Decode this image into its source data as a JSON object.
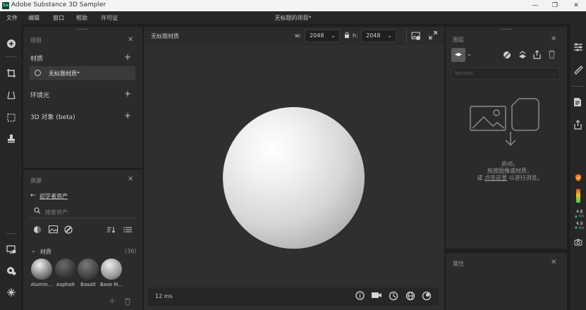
{
  "app": {
    "logo_text": "Sa",
    "title": "Adobe Substance 3D Sampler",
    "document_title": "无标题的项目*"
  },
  "window_controls": {
    "minimize": "—",
    "maximize": "❐",
    "close": "✕"
  },
  "menu": {
    "items": [
      "文件",
      "编辑",
      "窗口",
      "帮助",
      "许可证"
    ]
  },
  "left_toolbar": {
    "icons": [
      "plus-icon",
      "crop-icon",
      "perspective-icon",
      "transform-icon",
      "stamp-icon",
      "display-icon",
      "settings-icon",
      "network-icon"
    ]
  },
  "project_panel": {
    "title": "项目",
    "sections": {
      "materials": "材质",
      "environment": "环境光",
      "objects": "3D 对象 (beta)"
    },
    "material_item": "无标题材质*"
  },
  "assets_panel": {
    "title": "资源",
    "back_link": "初学者资产",
    "search_placeholder": "搜索资产",
    "category": "材质",
    "count": "(36)",
    "thumbnails": [
      {
        "label": "Alumin...",
        "color": "#c0c0c0"
      },
      {
        "label": "Asphalt",
        "color": "#3a3a3a"
      },
      {
        "label": "Basalt",
        "color": "#4a4a4a"
      },
      {
        "label": "Base M...",
        "color": "#b0b0b0"
      }
    ]
  },
  "viewport": {
    "tab_title": "无标题材质",
    "width_label": "w:",
    "width_value": "2048",
    "height_label": "h:",
    "height_value": "2048",
    "render_time": "12 ms"
  },
  "layers_panel": {
    "title": "图层",
    "blend_mode": "Normal",
    "drop_line1": "启动。",
    "drop_line2": "拖放图像或材质，",
    "drop_line3_prefix": "或",
    "drop_link": "点击这里",
    "drop_line3_suffix": "以进行浏览。"
  },
  "properties_panel": {
    "title": "属性"
  },
  "right_toolbar": {
    "stat1": "4.8",
    "stat1_unit": "K/s",
    "stat2": "4.9",
    "stat2_unit": "K/s"
  }
}
